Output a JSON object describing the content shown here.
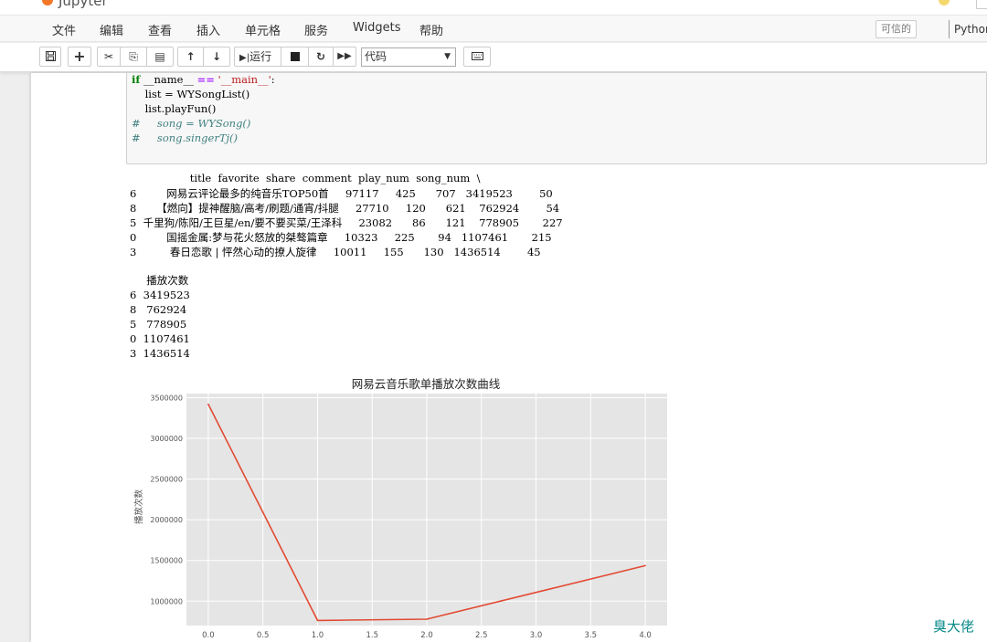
{
  "header": {
    "logo_text": "Jupyter"
  },
  "menu": {
    "items": [
      "文件",
      "编辑",
      "查看",
      "插入",
      "单元格",
      "服务",
      "Widgets",
      "帮助"
    ],
    "trusted_label": "可信的",
    "kernel_name": "Python"
  },
  "toolbar": {
    "save_icon": "floppy-icon",
    "add_icon": "plus-icon",
    "run_label": "运行",
    "cell_type_value": "代码"
  },
  "code": {
    "line1_kw": "if",
    "line1_a": " __name__ ",
    "line1_op": "==",
    "line1_str": " '__main__'",
    "line1_end": ":",
    "line2": "    list = WYSongList()",
    "line3": "    list.playFun()",
    "line4": "#     song = WYSong()",
    "line5": "#     song.singerTj()"
  },
  "output": {
    "df_header": "                  title  favorite  share  comment  play_num  song_num  \\",
    "df_rows": [
      "6         网易云评论最多的纯音乐TOP50首     97117     425      707   3419523        50",
      "8      【燃向】提神醒脑/高考/刷题/通宵/抖腿     27710     120      621    762924        54",
      "5  千里狗/陈阳/王巨星/en/要不要买菜/王泽科     23082      86      121    778905       227",
      "0         国摇金属:梦与花火怒放的桀骜篇章     10323     225       94   1107461       215",
      "3          春日恋歌 | 怦然心动的撩人旋律     10011     155      130   1436514        45"
    ],
    "series_header": "     播放次数",
    "series_rows": [
      "6  3419523",
      "8   762924",
      "5   778905",
      "0  1107461",
      "3  1436514"
    ]
  },
  "chart_data": {
    "type": "line",
    "title": "网易云音乐歌单播放次数曲线",
    "xlabel": "",
    "ylabel": "播放次数",
    "x": [
      0,
      1,
      2,
      3,
      4
    ],
    "series": [
      {
        "values": [
          3419523,
          762924,
          778905,
          1107461,
          1436514
        ]
      }
    ],
    "xlim": [
      -0.2,
      4.2
    ],
    "ylim": [
      700000,
      3550000
    ],
    "xticks": [
      0.0,
      0.5,
      1.0,
      1.5,
      2.0,
      2.5,
      3.0,
      3.5,
      4.0
    ],
    "xtick_labels": [
      "0.0",
      "0.5",
      "1.0",
      "1.5",
      "2.0",
      "2.5",
      "3.0",
      "3.5",
      "4.0"
    ],
    "yticks": [
      1000000,
      1500000,
      2000000,
      2500000,
      3000000,
      3500000
    ],
    "ytick_labels": [
      "1000000",
      "1500000",
      "2000000",
      "2500000",
      "3000000",
      "3500000"
    ],
    "grid": true,
    "line_color": "#e24a33",
    "background_color": "#e5e5e5"
  },
  "watermark": "臭大佬"
}
